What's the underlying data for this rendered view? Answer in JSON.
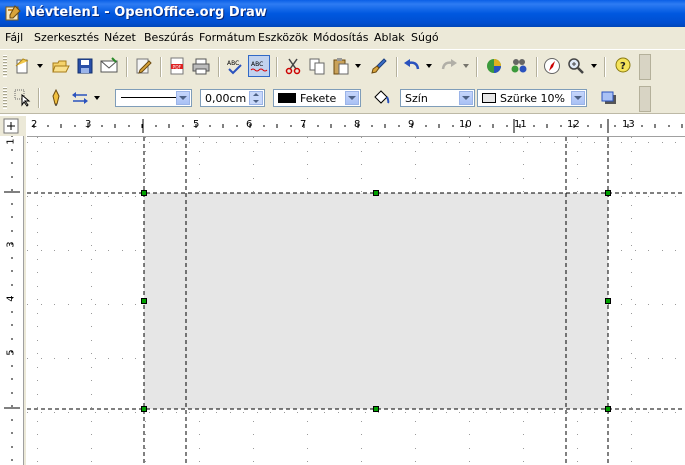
{
  "window": {
    "title": "Névtelen1 - OpenOffice.org Draw"
  },
  "menu": [
    {
      "label": "Fájl"
    },
    {
      "label": "Szerkesztés"
    },
    {
      "label": "Nézet"
    },
    {
      "label": "Beszúrás"
    },
    {
      "label": "Formátum"
    },
    {
      "label": "Eszközök"
    },
    {
      "label": "Módosítás"
    },
    {
      "label": "Ablak"
    },
    {
      "label": "Súgó"
    }
  ],
  "toolbar2": {
    "line_width": "0,00cm",
    "line_color": "Fekete",
    "line_color_hex": "#000000",
    "area_style": "Szín",
    "area_color": "Szürke 10%",
    "area_color_hex": "#e6e6e6"
  },
  "ruler": {
    "horizontal_numbers": [
      "2",
      "3",
      "5",
      "6",
      "7",
      "8",
      "9",
      "10",
      "11",
      "12",
      "13"
    ],
    "vertical_numbers": [
      "1",
      "3",
      "4",
      "5"
    ]
  },
  "shape": {
    "fill": "#e6e6e6",
    "handle_color": "#00a000"
  }
}
